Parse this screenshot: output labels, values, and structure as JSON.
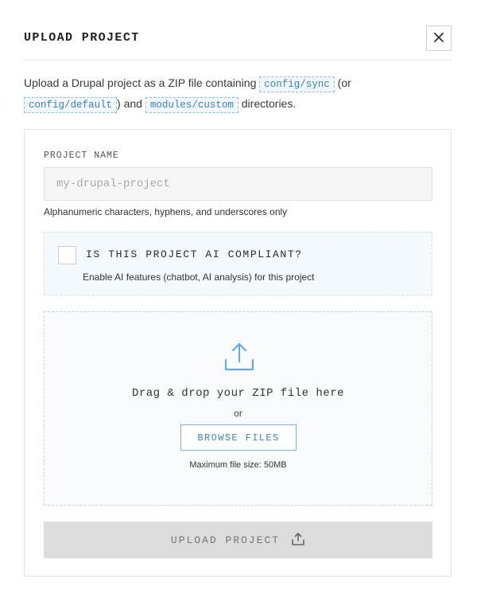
{
  "modal": {
    "title": "UPLOAD PROJECT",
    "close_icon": "close-icon"
  },
  "intro": {
    "text_1": "Upload a Drupal project as a ZIP file containing ",
    "code_1": "config/sync",
    "text_2": " (or",
    "code_2": "config/default",
    "text_3": ") and ",
    "code_3": "modules/custom",
    "text_4": " directories."
  },
  "form": {
    "project_name_label": "PROJECT NAME",
    "project_name_value": "",
    "project_name_placeholder": "my-drupal-project",
    "project_name_hint": "Alphanumeric characters, hyphens, and underscores only",
    "ai_compliant": {
      "checked": false,
      "title": "IS THIS PROJECT AI COMPLIANT?",
      "description": "Enable AI features (chatbot, AI analysis) for this project"
    },
    "drop_zone": {
      "icon": "upload-icon",
      "text": "Drag & drop your ZIP file here",
      "or": "or",
      "browse_label": "BROWSE FILES",
      "max_size": "Maximum file size: 50MB"
    },
    "submit": {
      "label": "UPLOAD PROJECT",
      "icon": "upload-icon",
      "disabled": true
    }
  },
  "colors": {
    "accent": "#3b82c4",
    "icon_blue": "#6aa6e0",
    "disabled_bg": "#dcdcdc"
  }
}
